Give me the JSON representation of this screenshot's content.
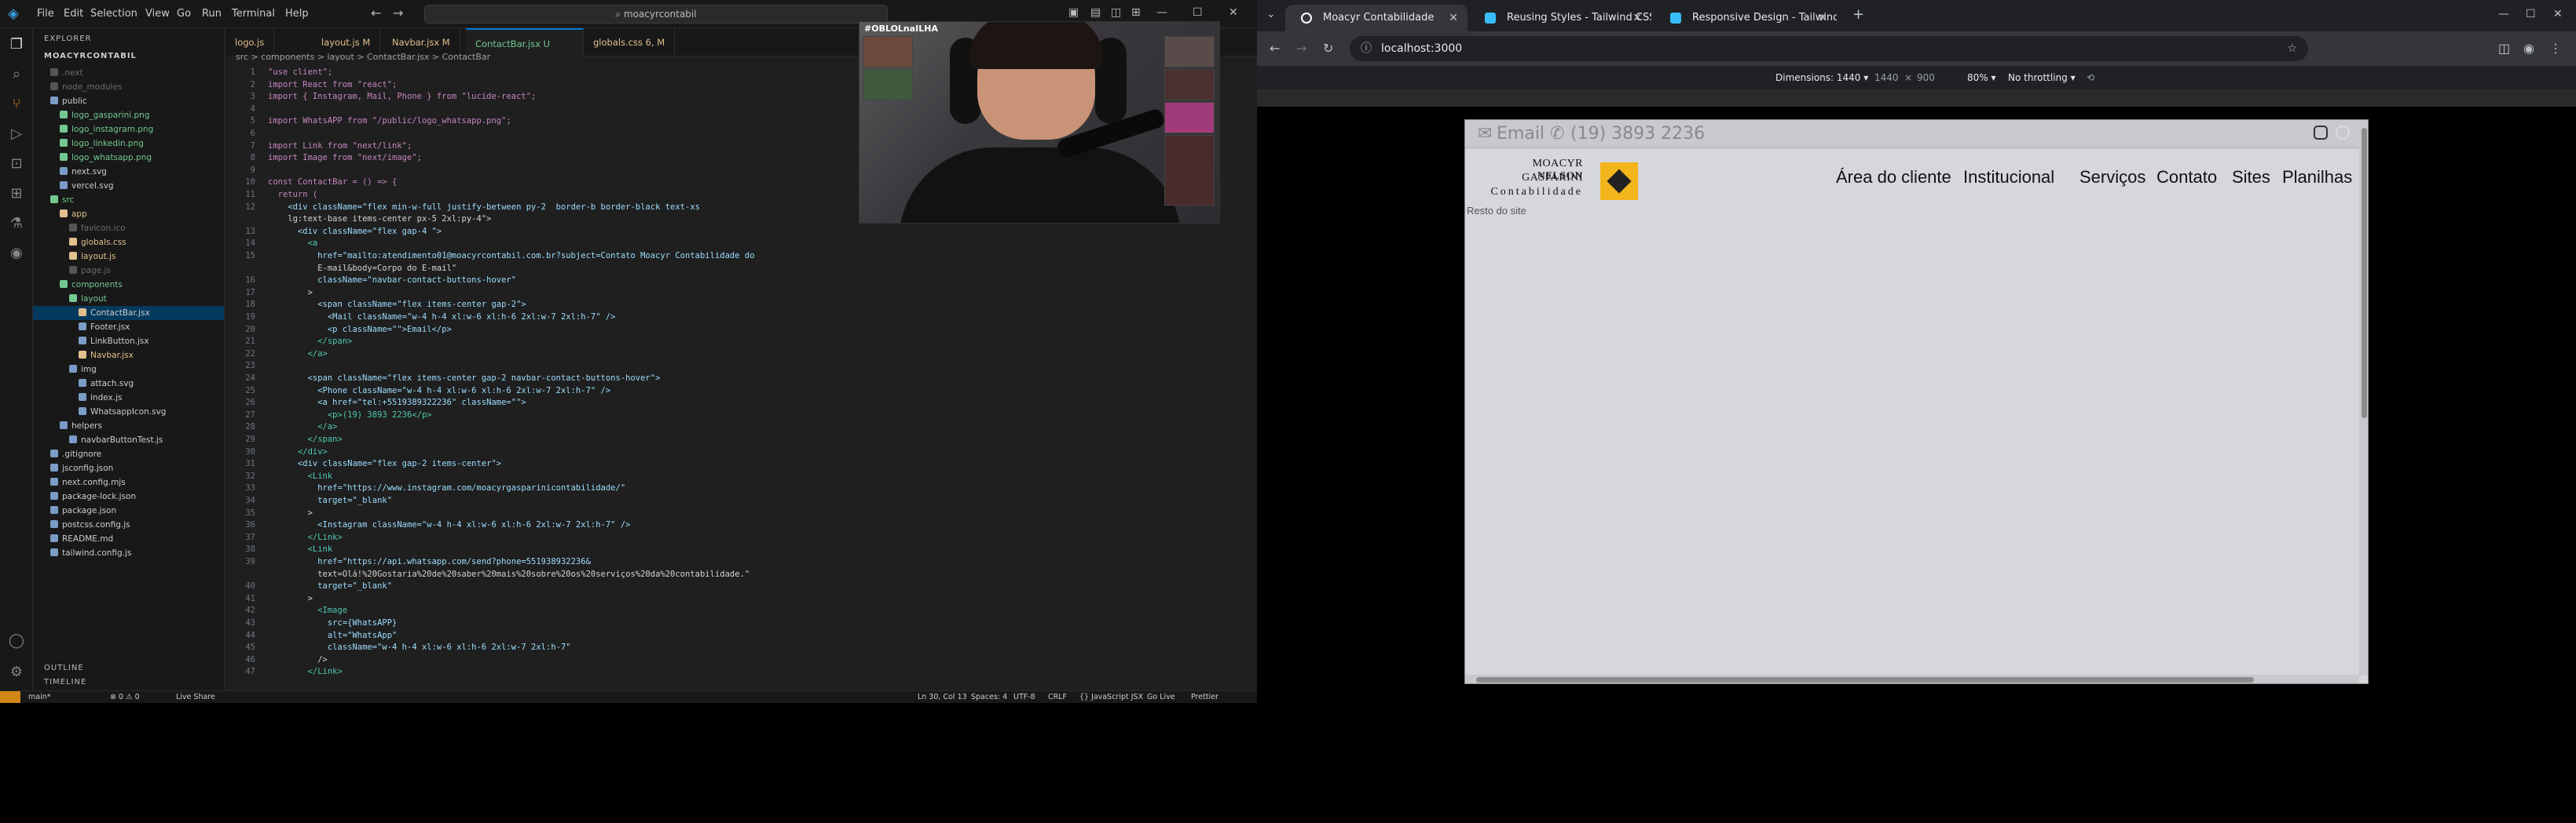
{
  "vscode": {
    "menus": [
      "File",
      "Edit",
      "Selection",
      "View",
      "Go",
      "Run",
      "Terminal",
      "Help"
    ],
    "search": "moacyrcontabil",
    "explorer_header": "EXPLORER",
    "project": "MOACYRCONTABIL",
    "tree": [
      {
        "label": ".next",
        "indent": 1,
        "style": "dim"
      },
      {
        "label": "node_modules",
        "indent": 1,
        "style": "dim"
      },
      {
        "label": "public",
        "indent": 1,
        "style": "normal"
      },
      {
        "label": "logo_gasparini.png",
        "indent": 2,
        "style": "green"
      },
      {
        "label": "logo_instagram.png",
        "indent": 2,
        "style": "green"
      },
      {
        "label": "logo_linkedin.png",
        "indent": 2,
        "style": "green"
      },
      {
        "label": "logo_whatsapp.png",
        "indent": 2,
        "style": "green"
      },
      {
        "label": "next.svg",
        "indent": 2,
        "style": "normal"
      },
      {
        "label": "vercel.svg",
        "indent": 2,
        "style": "normal"
      },
      {
        "label": "src",
        "indent": 1,
        "style": "green"
      },
      {
        "label": "app",
        "indent": 2,
        "style": "yellow"
      },
      {
        "label": "favicon.ico",
        "indent": 3,
        "style": "dim"
      },
      {
        "label": "globals.css",
        "indent": 3,
        "style": "yellow"
      },
      {
        "label": "layout.js",
        "indent": 3,
        "style": "yellow"
      },
      {
        "label": "page.js",
        "indent": 3,
        "style": "dim"
      },
      {
        "label": "components",
        "indent": 2,
        "style": "green"
      },
      {
        "label": "layout",
        "indent": 3,
        "style": "green"
      },
      {
        "label": "ContactBar.jsx",
        "indent": 4,
        "style": "sel"
      },
      {
        "label": "Footer.jsx",
        "indent": 4,
        "style": "normal"
      },
      {
        "label": "LinkButton.jsx",
        "indent": 4,
        "style": "normal"
      },
      {
        "label": "Navbar.jsx",
        "indent": 4,
        "style": "yellow"
      },
      {
        "label": "img",
        "indent": 3,
        "style": "normal"
      },
      {
        "label": "attach.svg",
        "indent": 4,
        "style": "normal"
      },
      {
        "label": "index.js",
        "indent": 4,
        "style": "normal"
      },
      {
        "label": "WhatsappIcon.svg",
        "indent": 4,
        "style": "normal"
      },
      {
        "label": "helpers",
        "indent": 2,
        "style": "normal"
      },
      {
        "label": "navbarButtonTest.js",
        "indent": 3,
        "style": "normal"
      },
      {
        "label": ".gitignore",
        "indent": 1,
        "style": "normal"
      },
      {
        "label": "jsconfig.json",
        "indent": 1,
        "style": "normal"
      },
      {
        "label": "next.config.mjs",
        "indent": 1,
        "style": "normal"
      },
      {
        "label": "package-lock.json",
        "indent": 1,
        "style": "normal"
      },
      {
        "label": "package.json",
        "indent": 1,
        "style": "normal"
      },
      {
        "label": "postcss.config.js",
        "indent": 1,
        "style": "normal"
      },
      {
        "label": "README.md",
        "indent": 1,
        "style": "normal"
      },
      {
        "label": "tailwind.config.js",
        "indent": 1,
        "style": "normal"
      }
    ],
    "outline": "OUTLINE",
    "timeline": "TIMELINE",
    "tabs": [
      "logo.js",
      "layout.js M",
      "Navbar.jsx M",
      "ContactBar.jsx U",
      "globals.css 6, M"
    ],
    "breadcrumb": "src > components > layout > ContactBar.jsx > ContactBar",
    "code": [
      {
        "n": "1",
        "t": "\"use client\";"
      },
      {
        "n": "2",
        "t": "import React from \"react\";"
      },
      {
        "n": "3",
        "t": "import { Instagram, Mail, Phone } from \"lucide-react\";"
      },
      {
        "n": "4",
        "t": ""
      },
      {
        "n": "5",
        "t": "import WhatsAPP from \"/public/logo_whatsapp.png\";"
      },
      {
        "n": "6",
        "t": ""
      },
      {
        "n": "7",
        "t": "import Link from \"next/link\";"
      },
      {
        "n": "8",
        "t": "import Image from \"next/image\";"
      },
      {
        "n": "9",
        "t": ""
      },
      {
        "n": "10",
        "t": "const ContactBar = () => {"
      },
      {
        "n": "11",
        "t": "  return ("
      },
      {
        "n": "12",
        "t": "    <div className=\"flex min-w-full justify-between py-2  border-b border-black text-xs"
      },
      {
        "n": "",
        "t": "    lg:text-base items-center px-5 2xl:py-4\">"
      },
      {
        "n": "13",
        "t": "      <div className=\"flex gap-4 \">"
      },
      {
        "n": "14",
        "t": "        <a"
      },
      {
        "n": "15",
        "t": "          href=\"mailto:atendimento01@moacyrcontabil.com.br?subject=Contato Moacyr Contabilidade do"
      },
      {
        "n": "",
        "t": "          E-mail&body=Corpo do E-mail\""
      },
      {
        "n": "16",
        "t": "          className=\"navbar-contact-buttons-hover\""
      },
      {
        "n": "17",
        "t": "        >"
      },
      {
        "n": "18",
        "t": "          <span className=\"flex items-center gap-2\">"
      },
      {
        "n": "19",
        "t": "            <Mail className=\"w-4 h-4 xl:w-6 xl:h-6 2xl:w-7 2xl:h-7\" />"
      },
      {
        "n": "20",
        "t": "            <p className=\"\">Email</p>"
      },
      {
        "n": "21",
        "t": "          </span>"
      },
      {
        "n": "22",
        "t": "        </a>"
      },
      {
        "n": "23",
        "t": ""
      },
      {
        "n": "24",
        "t": "        <span className=\"flex items-center gap-2 navbar-contact-buttons-hover\">"
      },
      {
        "n": "25",
        "t": "          <Phone className=\"w-4 h-4 xl:w-6 xl:h-6 2xl:w-7 2xl:h-7\" />"
      },
      {
        "n": "26",
        "t": "          <a href=\"tel:+5519389322236\" className=\"\">"
      },
      {
        "n": "27",
        "t": "            <p>(19) 3893 2236</p>"
      },
      {
        "n": "28",
        "t": "          </a>"
      },
      {
        "n": "29",
        "t": "        </span>"
      },
      {
        "n": "30",
        "t": "      </div>"
      },
      {
        "n": "31",
        "t": "      <div className=\"flex gap-2 items-center\">"
      },
      {
        "n": "32",
        "t": "        <Link"
      },
      {
        "n": "33",
        "t": "          href=\"https://www.instagram.com/moacyrgasparinicontabilidade/\""
      },
      {
        "n": "34",
        "t": "          target=\"_blank\""
      },
      {
        "n": "35",
        "t": "        >"
      },
      {
        "n": "36",
        "t": "          <Instagram className=\"w-4 h-4 xl:w-6 xl:h-6 2xl:w-7 2xl:h-7\" />"
      },
      {
        "n": "37",
        "t": "        </Link>"
      },
      {
        "n": "38",
        "t": "        <Link"
      },
      {
        "n": "39",
        "t": "          href=\"https://api.whatsapp.com/send?phone=551938932236&"
      },
      {
        "n": "",
        "t": "          text=Olá!%20Gostaria%20de%20saber%20mais%20sobre%20os%20serviços%20da%20contabilidade.\""
      },
      {
        "n": "40",
        "t": "          target=\"_blank\""
      },
      {
        "n": "41",
        "t": "        >"
      },
      {
        "n": "42",
        "t": "          <Image"
      },
      {
        "n": "43",
        "t": "            src={WhatsAPP}"
      },
      {
        "n": "44",
        "t": "            alt=\"WhatsApp\""
      },
      {
        "n": "45",
        "t": "            className=\"w-4 h-4 xl:w-6 xl:h-6 2xl:w-7 2xl:h-7\""
      },
      {
        "n": "46",
        "t": "          />"
      },
      {
        "n": "47",
        "t": "        </Link>"
      }
    ],
    "status": {
      "branch": "main*",
      "errors": "⊗ 0 ⚠ 0",
      "live": "Live Share",
      "pos": "Ln 30, Col 13",
      "spaces": "Spaces: 4",
      "enc": "UTF-8",
      "eol": "CRLF",
      "lang": "{} JavaScript JSX",
      "golive": "Go Live",
      "prettier": "Prettier"
    },
    "stream": {
      "overlay": "#OBLOLnaILHA"
    }
  },
  "chrome": {
    "tabs": [
      {
        "label": "Moacyr Contabilidade",
        "active": true,
        "fav": "#ffffff"
      },
      {
        "label": "Reusing Styles - Tailwind CSS",
        "active": false,
        "fav": "#38bdf8"
      },
      {
        "label": "Responsive Design - Tailwind C",
        "active": false,
        "fav": "#38bdf8"
      }
    ],
    "url": "localhost:3000",
    "devtools": {
      "dimensions": "Dimensions: 1440 ▾",
      "width": "1440",
      "x": "×",
      "height": "900",
      "zoom": "80% ▾",
      "throttling": "No throttling ▾"
    },
    "page": {
      "email": "Email",
      "phone": "(19) 3893 2236",
      "logo_line1": "MOACYR NELSON",
      "logo_line2": "GASPARINI",
      "logo_line3": "Contabilidade",
      "nav": [
        "Área do cliente",
        "Institucional",
        "Serviços",
        "Contato",
        "Sites",
        "Planilhas"
      ],
      "body": "Resto do site"
    }
  }
}
